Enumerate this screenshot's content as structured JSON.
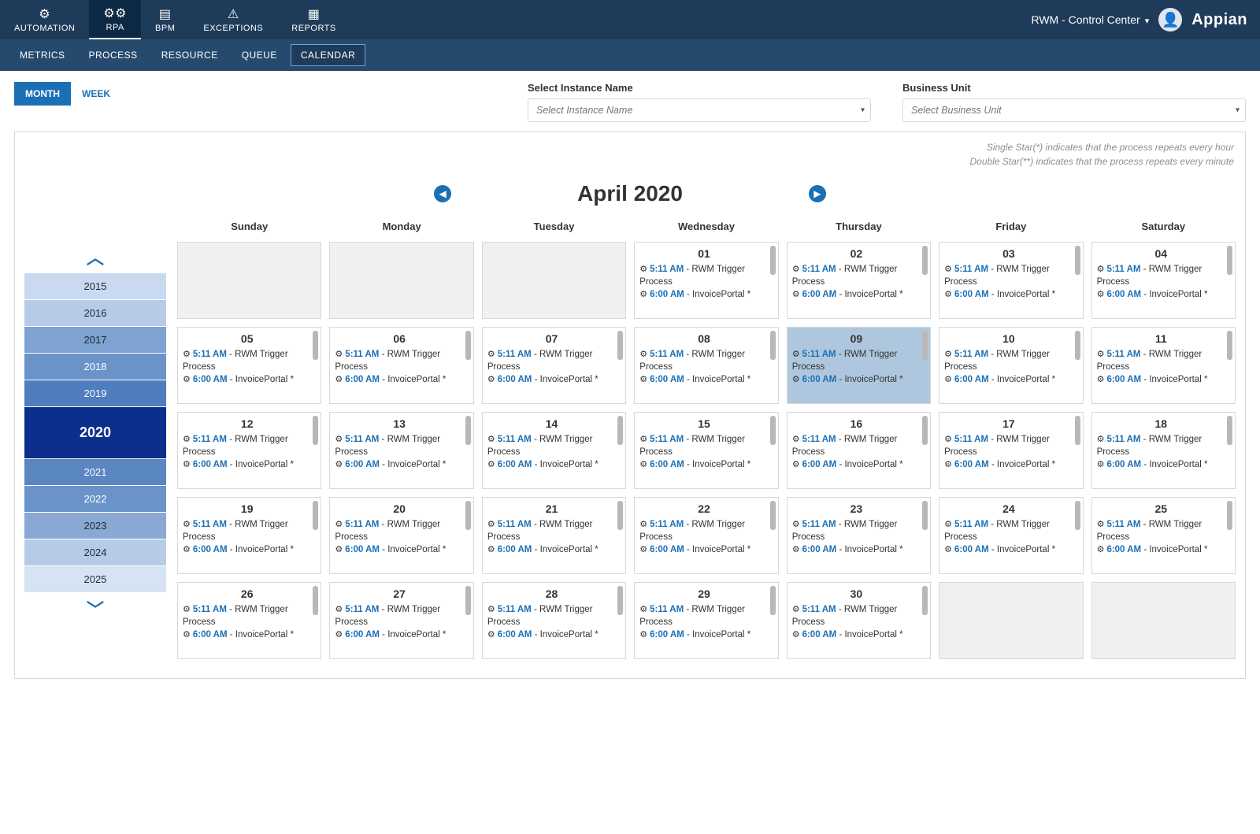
{
  "top_nav": {
    "items": [
      {
        "label": "AUTOMATION",
        "icon": "⚙"
      },
      {
        "label": "RPA",
        "icon": "⚙⚙",
        "active": true
      },
      {
        "label": "BPM",
        "icon": "▤"
      },
      {
        "label": "EXCEPTIONS",
        "icon": "⚠"
      },
      {
        "label": "REPORTS",
        "icon": "▦"
      }
    ],
    "app_menu": "RWM - Control Center",
    "brand": "Appian"
  },
  "sub_nav": {
    "tabs": [
      "METRICS",
      "PROCESS",
      "RESOURCE",
      "QUEUE",
      "CALENDAR"
    ],
    "active": "CALENDAR"
  },
  "view_toggle": {
    "month": "MONTH",
    "week": "WEEK",
    "active": "MONTH"
  },
  "filters": {
    "instance": {
      "label": "Select Instance Name",
      "placeholder": "Select Instance Name"
    },
    "bu": {
      "label": "Business Unit",
      "placeholder": "Select Business Unit"
    }
  },
  "legend": {
    "line1": "Single Star(*) indicates that the process repeats every hour",
    "line2": "Double Star(**) indicates that the process repeats every minute"
  },
  "calendar": {
    "title": "April 2020",
    "weekdays": [
      "Sunday",
      "Monday",
      "Tuesday",
      "Wednesday",
      "Thursday",
      "Friday",
      "Saturday"
    ],
    "years": [
      "2015",
      "2016",
      "2017",
      "2018",
      "2019",
      "2020",
      "2021",
      "2022",
      "2023",
      "2024",
      "2025"
    ],
    "current_year": "2020",
    "highlight_day": "09",
    "event_template": {
      "e1_time": "5:11 AM",
      "e1_text": " - RWM Trigger Process",
      "e2_time": "6:00 AM",
      "e2_text": " - InvoicePortal *"
    },
    "weeks": [
      [
        {
          "blank": true
        },
        {
          "blank": true
        },
        {
          "blank": true
        },
        {
          "d": "01"
        },
        {
          "d": "02"
        },
        {
          "d": "03"
        },
        {
          "d": "04"
        }
      ],
      [
        {
          "d": "05"
        },
        {
          "d": "06"
        },
        {
          "d": "07"
        },
        {
          "d": "08"
        },
        {
          "d": "09"
        },
        {
          "d": "10"
        },
        {
          "d": "11"
        }
      ],
      [
        {
          "d": "12"
        },
        {
          "d": "13"
        },
        {
          "d": "14"
        },
        {
          "d": "15"
        },
        {
          "d": "16"
        },
        {
          "d": "17"
        },
        {
          "d": "18"
        }
      ],
      [
        {
          "d": "19"
        },
        {
          "d": "20"
        },
        {
          "d": "21"
        },
        {
          "d": "22"
        },
        {
          "d": "23"
        },
        {
          "d": "24"
        },
        {
          "d": "25"
        }
      ],
      [
        {
          "d": "26"
        },
        {
          "d": "27"
        },
        {
          "d": "28"
        },
        {
          "d": "29"
        },
        {
          "d": "30"
        },
        {
          "blank": true
        },
        {
          "blank": true
        }
      ]
    ]
  }
}
